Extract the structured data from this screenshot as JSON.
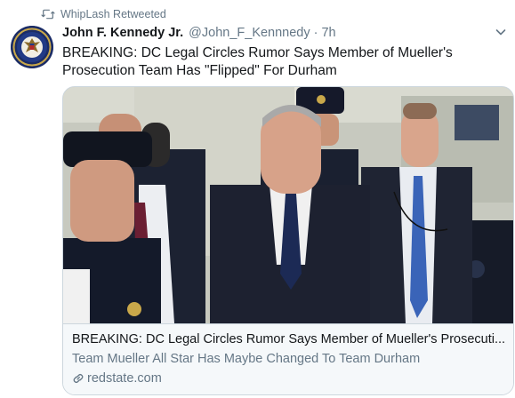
{
  "retweet": {
    "text": "WhipLash Retweeted",
    "icon": "retweet-icon"
  },
  "author": {
    "name": "John F. Kennedy Jr.",
    "handle": "@John_F_Kennnedy",
    "separator": "·",
    "time": "7h",
    "avatar_icon": "presidential-seal-avatar"
  },
  "tweet": {
    "text": "BREAKING: DC Legal Circles Rumor Says Member of Mueller's Prosecution Team Has \"Flipped\" For Durham"
  },
  "card": {
    "title": "BREAKING: DC Legal Circles Rumor Says Member of Mueller's Prosecuti...",
    "description": "Team Mueller All Star Has Maybe Changed To Team Durham",
    "domain": "redstate.com",
    "link_icon": "link-icon"
  },
  "colors": {
    "text_primary": "#14171a",
    "text_secondary": "#657786",
    "card_border": "#ccd6dd",
    "card_footer_bg": "#f5f8fa"
  }
}
